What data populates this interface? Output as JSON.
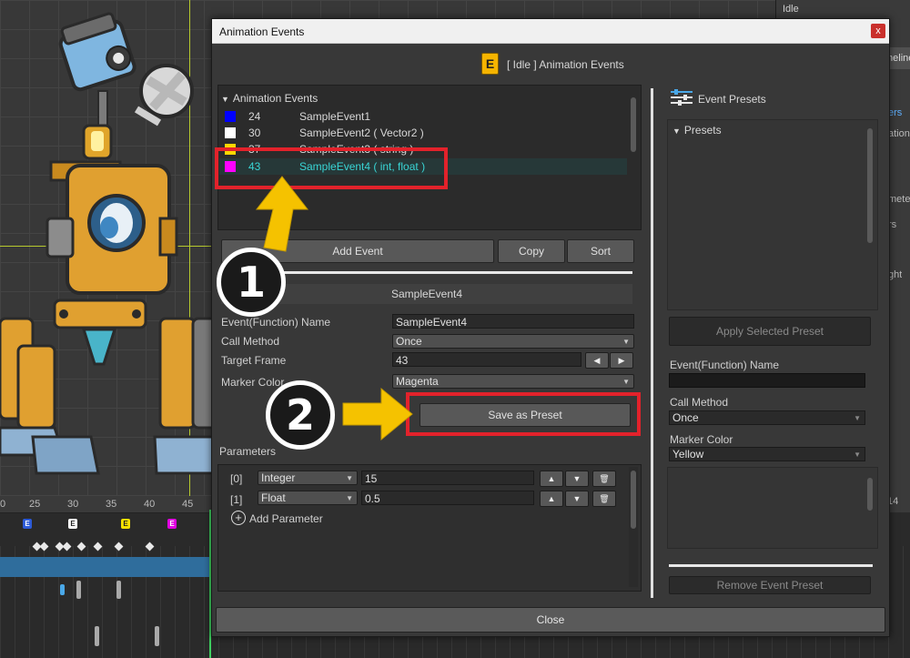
{
  "scene": {
    "right_panel": {
      "idle_label": "Idle",
      "tab_fragment": "meline",
      "frag1": "ers",
      "frag2": "ation",
      "frag3": "meter",
      "frag4": "rs",
      "frag5": "ght"
    },
    "ruler_ticks": [
      "0",
      "25",
      "30",
      "35",
      "40",
      "45"
    ],
    "ruler_right": "14",
    "event_marker_glyph": "E"
  },
  "dialog": {
    "window_title": "Animation Events",
    "close_glyph": "x",
    "header_icon_glyph": "E",
    "header_text": "[ Idle ] Animation Events",
    "events_list": {
      "title": "Animation Events",
      "items": [
        {
          "frame": "24",
          "name": "SampleEvent1",
          "color": "#0000ff"
        },
        {
          "frame": "30",
          "name": "SampleEvent2  ( Vector2 )",
          "color": "#ffffff"
        },
        {
          "frame": "37",
          "name": "SampleEvent3  ( string )",
          "color": "#ffd700"
        },
        {
          "frame": "43",
          "name": "SampleEvent4  ( int, float )",
          "color": "#ff00ff",
          "selected": true
        }
      ]
    },
    "buttons": {
      "add_event": "Add Event",
      "copy": "Copy",
      "sort": "Sort",
      "save_as_preset": "Save as Preset",
      "close": "Close"
    },
    "detail": {
      "section_title": "SampleEvent4",
      "name_label": "Event(Function) Name",
      "name_value": "SampleEvent4",
      "call_method_label": "Call Method",
      "call_method_value": "Once",
      "target_frame_label": "Target Frame",
      "target_frame_value": "43",
      "marker_color_label": "Marker Color",
      "marker_color_value": "Magenta"
    },
    "parameters": {
      "title": "Parameters",
      "rows": [
        {
          "index": "[0]",
          "type": "Integer",
          "value": "15"
        },
        {
          "index": "[1]",
          "type": "Float",
          "value": "0.5"
        }
      ],
      "add_label": "Add Parameter"
    },
    "presets": {
      "title": "Event Presets",
      "list_title": "Presets",
      "apply_button": "Apply Selected Preset",
      "name_label": "Event(Function) Name",
      "name_value": "",
      "call_method_label": "Call Method",
      "call_method_value": "Once",
      "marker_color_label": "Marker Color",
      "marker_color_value": "Yellow",
      "remove_button": "Remove Event Preset"
    }
  },
  "annotations": {
    "step1": "1",
    "step2": "2",
    "highlight_color": "#e3222b",
    "arrow_color": "#f5c200"
  }
}
